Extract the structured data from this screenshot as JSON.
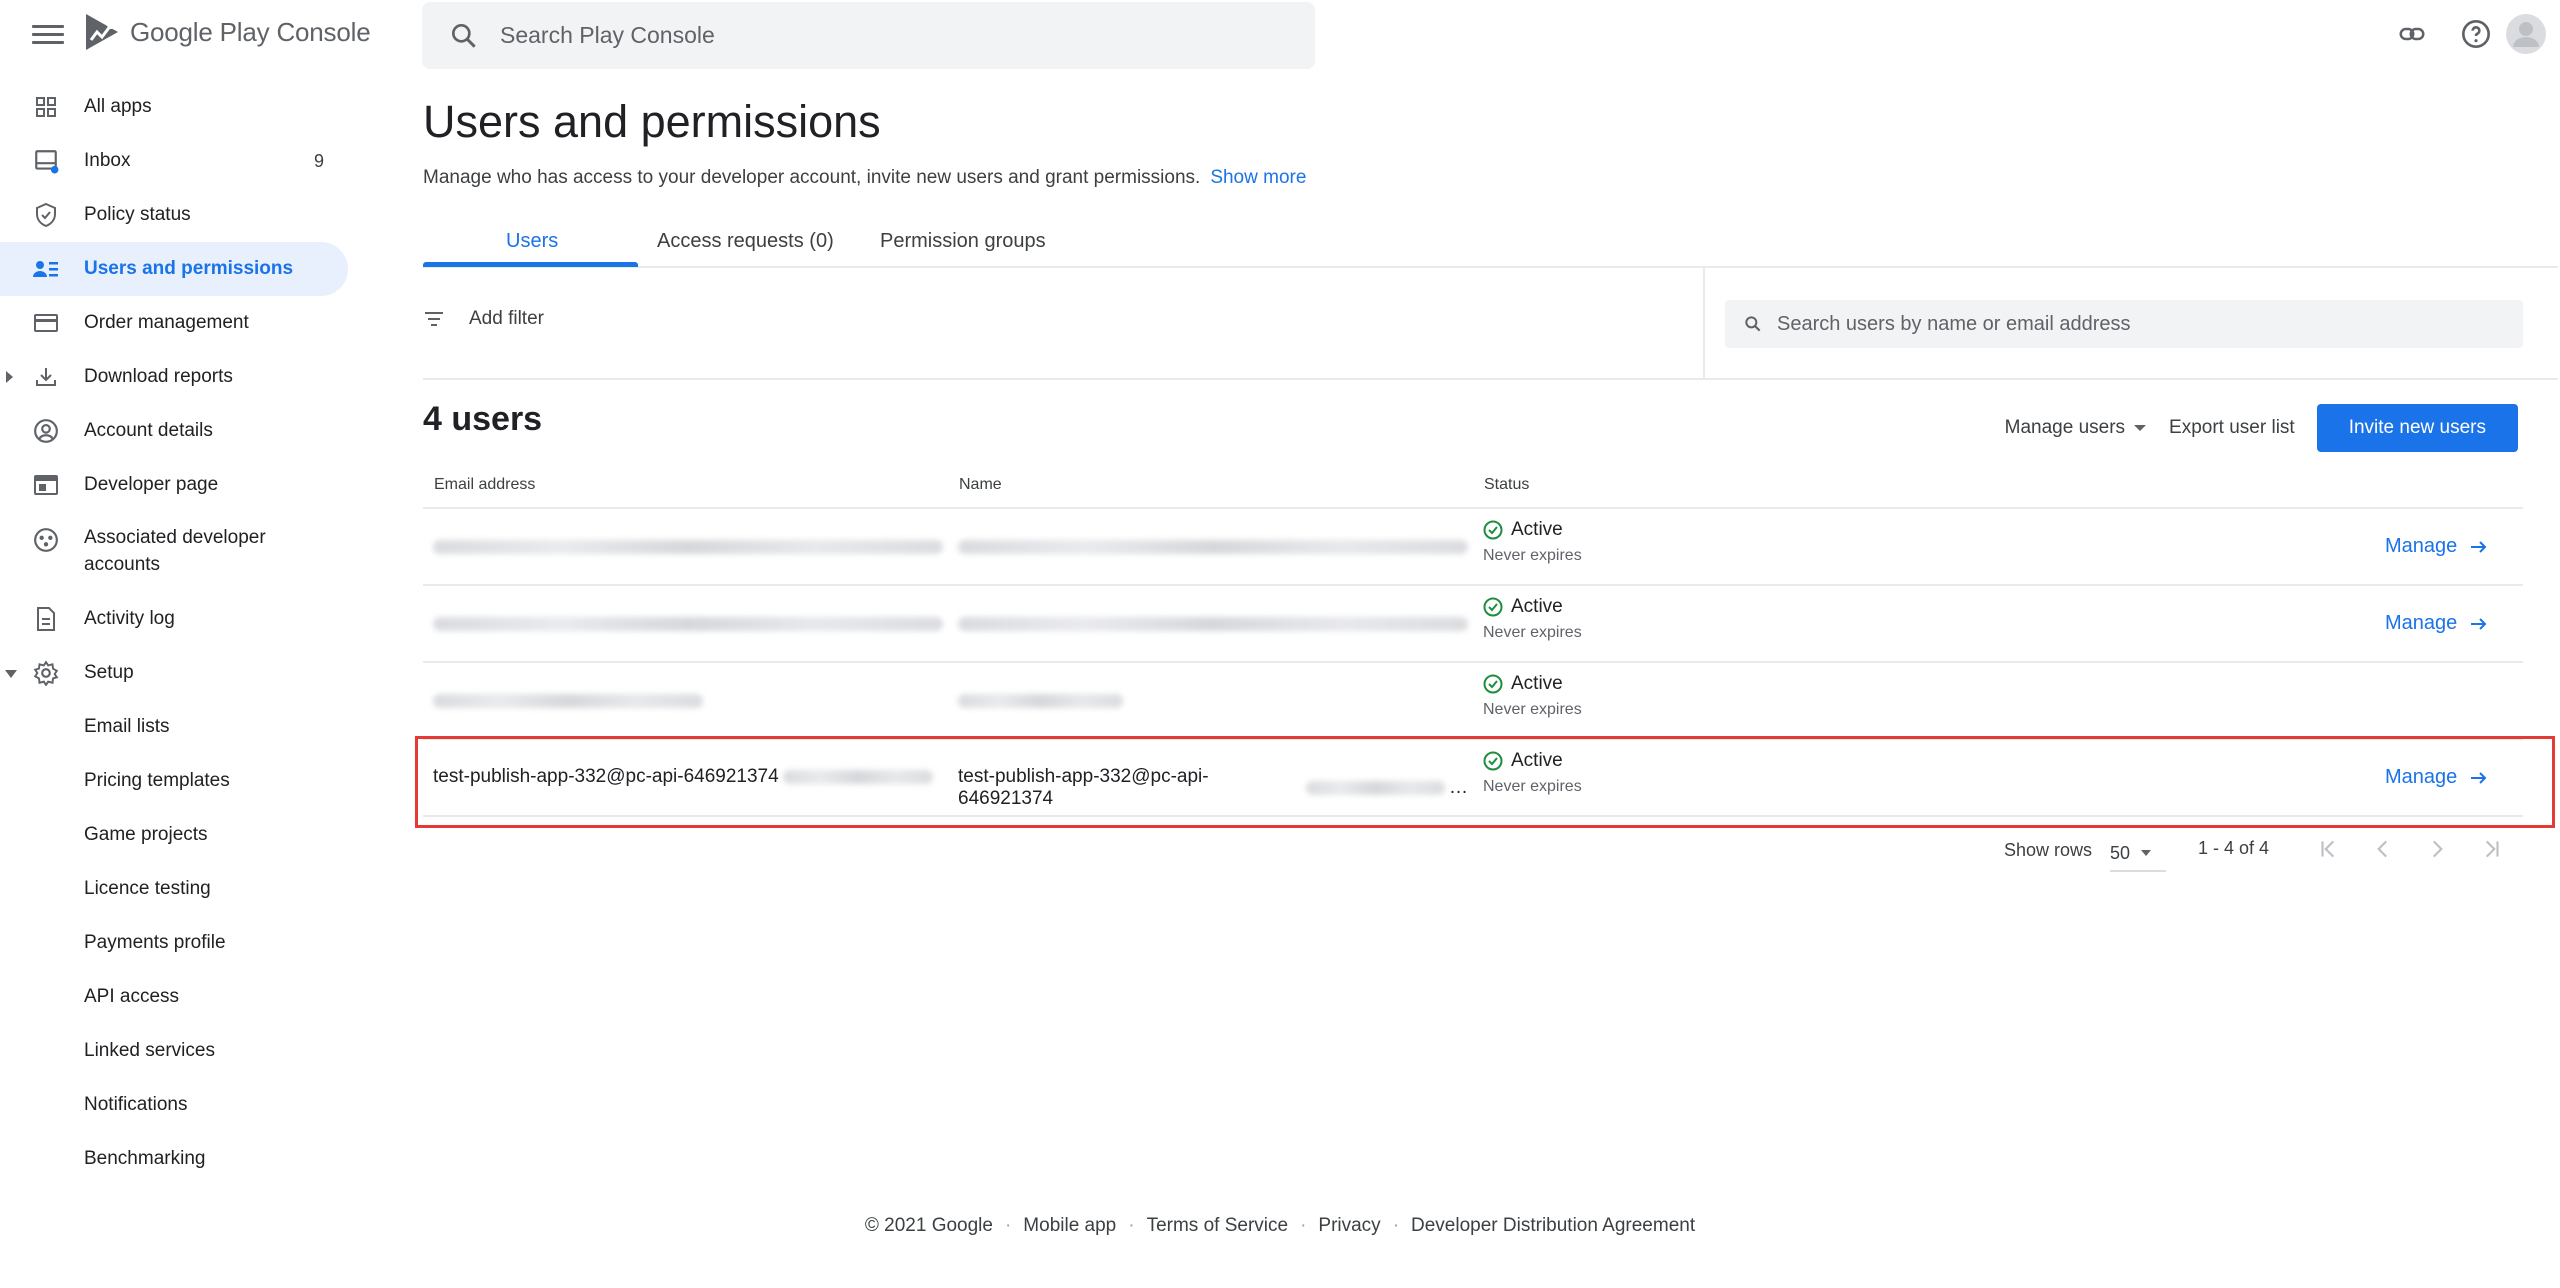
{
  "header": {
    "app_name": "Google Play Console",
    "search_placeholder": "Search Play Console"
  },
  "sidebar": {
    "items": [
      {
        "label": "All apps",
        "icon": "grid-icon"
      },
      {
        "label": "Inbox",
        "icon": "inbox-icon",
        "count": "9"
      },
      {
        "label": "Policy status",
        "icon": "shield-icon"
      },
      {
        "label": "Users and permissions",
        "icon": "users-icon",
        "active": true
      },
      {
        "label": "Order management",
        "icon": "credit-card-icon"
      },
      {
        "label": "Download reports",
        "icon": "download-icon"
      },
      {
        "label": "Account details",
        "icon": "account-circle-icon"
      },
      {
        "label": "Developer page",
        "icon": "web-page-icon"
      },
      {
        "label": "Associated developer accounts",
        "icon": "group-circle-icon"
      },
      {
        "label": "Activity log",
        "icon": "document-icon"
      },
      {
        "label": "Setup",
        "icon": "gear-icon"
      }
    ],
    "setup_items": [
      "Email lists",
      "Pricing templates",
      "Game projects",
      "Licence testing",
      "Payments profile",
      "API access",
      "Linked services",
      "Notifications",
      "Benchmarking"
    ]
  },
  "main": {
    "title": "Users and permissions",
    "description": "Manage who has access to your developer account, invite new users and grant permissions.",
    "show_more": "Show more",
    "tabs": [
      "Users",
      "Access requests (0)",
      "Permission groups"
    ],
    "add_filter": "Add filter",
    "user_search_placeholder": "Search users by name or email address",
    "user_count": "4 users",
    "manage_users": "Manage users",
    "export": "Export user list",
    "invite": "Invite new users",
    "columns": [
      "Email address",
      "Name",
      "Status"
    ],
    "rows": [
      {
        "status": "Active",
        "expires": "Never expires",
        "action": "Manage"
      },
      {
        "status": "Active",
        "expires": "Never expires",
        "action": "Manage"
      },
      {
        "status": "Active",
        "expires": "Never expires",
        "action": ""
      },
      {
        "email": "test-publish-app-332@pc-api-646921374",
        "name": "test-publish-app-332@pc-api-646921374",
        "name_ellipsis": "…",
        "status": "Active",
        "expires": "Never expires",
        "action": "Manage"
      }
    ],
    "pagination": {
      "show_rows_label": "Show rows",
      "rows_per_page": "50",
      "range": "1 - 4 of 4"
    }
  },
  "footer": {
    "copyright": "© 2021 Google",
    "links": [
      "Mobile app",
      "Terms of Service",
      "Privacy",
      "Developer Distribution Agreement"
    ]
  },
  "colors": {
    "accent": "#1a73e8",
    "highlight": "#e53935",
    "active_bg": "#e8f0fe",
    "success": "#1e8e3e"
  }
}
